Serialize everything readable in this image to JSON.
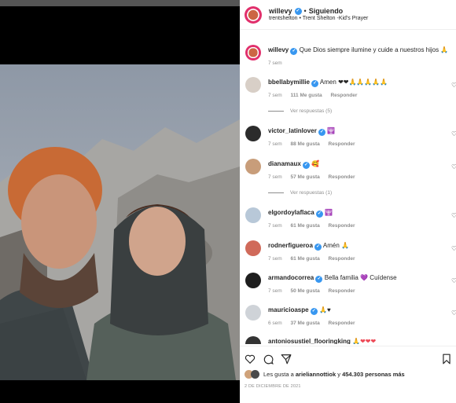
{
  "post": {
    "author": "willevy",
    "follow_state": "Siguiendo",
    "audio": "trentshelton • Trent Shelton -Kid's Prayer",
    "caption_author": "willevy",
    "caption_text": "Que Dios siempre ilumine y cuide a nuestros hijos",
    "caption_time": "7 sem",
    "likes_prefix": "Les gusta a",
    "likes_user": "arieliannottiok",
    "likes_connector": "y",
    "likes_count": "454.303 personas más",
    "date": "2 DE DICIEMBRE DE 2021"
  },
  "comments": [
    {
      "user": "bbellabymillie",
      "verified": true,
      "text": "Amen",
      "emoji": "❤❤🙏🙏🙏🙏🙏",
      "time": "7 sem",
      "likes": "111 Me gusta",
      "reply": "Responder",
      "view_replies": "Ver respuestas (5)"
    },
    {
      "user": "victor_latinlover",
      "verified": true,
      "text": "",
      "emoji": "🕎",
      "time": "7 sem",
      "likes": "88 Me gusta",
      "reply": "Responder",
      "view_replies": ""
    },
    {
      "user": "dianamaux",
      "verified": true,
      "text": "",
      "emoji": "🥰",
      "time": "7 sem",
      "likes": "57 Me gusta",
      "reply": "Responder",
      "view_replies": "Ver respuestas (1)"
    },
    {
      "user": "elgordoylaflaca",
      "verified": true,
      "text": "",
      "emoji": "🕎",
      "time": "7 sem",
      "likes": "61 Me gusta",
      "reply": "Responder",
      "view_replies": ""
    },
    {
      "user": "rodnerfigueroa",
      "verified": true,
      "text": "Amén",
      "emoji": "🙏",
      "time": "7 sem",
      "likes": "61 Me gusta",
      "reply": "Responder",
      "view_replies": ""
    },
    {
      "user": "armandocorrea",
      "verified": true,
      "text": "Bella familia",
      "emoji": "💜",
      "text2": "Cuídense",
      "time": "7 sem",
      "likes": "50 Me gusta",
      "reply": "Responder",
      "view_replies": ""
    },
    {
      "user": "mauricioaspe",
      "verified": true,
      "text": "",
      "emoji": "🙏♥",
      "time": "6 sem",
      "likes": "37 Me gusta",
      "reply": "Responder",
      "view_replies": ""
    },
    {
      "user": "antoniosustiel_flooringking",
      "verified": false,
      "text": "",
      "emoji": "🙏❤❤❤",
      "time": "",
      "likes": "",
      "reply": "",
      "view_replies": ""
    }
  ],
  "icons": {
    "like": "heart-outline-icon",
    "comment": "comment-bubble-icon",
    "share": "paper-plane-icon",
    "save": "bookmark-icon",
    "verified": "verified-badge-icon",
    "comment_like": "small-heart-icon"
  },
  "colors": {
    "verified": "#3897f0",
    "heart": "#ed4956",
    "text": "#262626",
    "secondary": "#8e8e8e"
  }
}
